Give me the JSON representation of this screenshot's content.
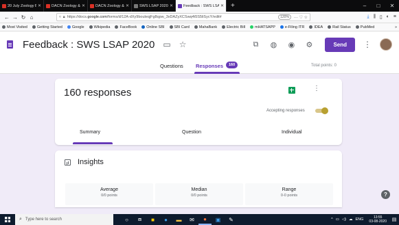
{
  "browser": {
    "tabs": [
      {
        "title": "20 July Zoology Botany - ex",
        "icon_color": "#d93025",
        "active": false
      },
      {
        "title": "DACN Zoology & Botany",
        "icon_color": "#d93025",
        "active": false
      },
      {
        "title": "DACN Zoology & Botany",
        "icon_color": "#d93025",
        "active": false
      },
      {
        "title": "SWS LSAP 2020 BROCHURE.cdr",
        "icon_color": "#777777",
        "active": false
      },
      {
        "title": "Feedback : SWS LSAP 2020",
        "icon_color": "#673ab7",
        "active": true
      }
    ],
    "new_tab": "+",
    "window_controls": [
      "–",
      "□",
      "✕"
    ],
    "url_prefix": "https://docs.",
    "url_host": "google.com",
    "url_rest": "/forms/d/12A-dXy9bouleqjFg8qpw_3xDAZyXCSwq4t5S5liSycY/edit#",
    "zoom": "120%",
    "bookmarks": [
      "Most Visited",
      "Getting Started",
      "Google",
      "Wikipedia",
      "FaceBook",
      "Online SBI",
      "SBI Card",
      "MahaBank",
      "Electric Bill",
      "mHATSAPP",
      "e-Filing ITR",
      "IDEA",
      "Rail Status",
      "PubMed"
    ],
    "bookmarks_more": "»"
  },
  "form": {
    "title": "Feedback : SWS LSAP 2020",
    "send_label": "Send",
    "tabs": {
      "questions": "Questions",
      "responses": "Responses",
      "responses_badge": "160"
    },
    "total_points": "Total points: 0"
  },
  "responses": {
    "count_label": "160 responses",
    "accepting_label": "Accepting responses",
    "accepting_on": true,
    "view_tabs": {
      "summary": "Summary",
      "question": "Question",
      "individual": "Individual"
    }
  },
  "insights": {
    "title": "Insights",
    "stats": {
      "average": {
        "label": "Average",
        "value": "0/0 points"
      },
      "median": {
        "label": "Median",
        "value": "0/0 points"
      },
      "range": {
        "label": "Range",
        "value": "0-0 points"
      }
    }
  },
  "help_label": "?",
  "taskbar": {
    "search_placeholder": "Type here to search",
    "language": "ENG",
    "time": "13:55",
    "date": "03-08-2020"
  },
  "colors": {
    "accent": "#673ab7",
    "page_background": "#f0ebf8",
    "toggle_on": "#b8a031"
  }
}
